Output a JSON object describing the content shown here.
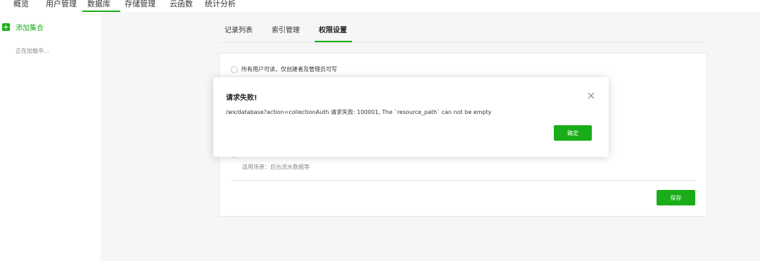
{
  "topnav": {
    "tabs": [
      "概览",
      "用户管理",
      "数据库",
      "存储管理",
      "云函数",
      "统计分析"
    ],
    "active_index": 2
  },
  "sidebar": {
    "add_label": "添加集合",
    "loading_text": "正在加载中..."
  },
  "content_tabs": {
    "tabs": [
      "记录列表",
      "索引管理",
      "权限设置"
    ],
    "active_index": 2
  },
  "permissions": {
    "option_1": "所有用户可读，仅创建者及管理员可写",
    "scene_text": "适用场景：后台流水数据等",
    "save_label": "保存"
  },
  "modal": {
    "title": "请求失败!",
    "message": "/wx/database?action=collectionAuth 请求失败: 100001, The `resource_path` can not be empty",
    "confirm_label": "确定"
  },
  "colors": {
    "accent": "#1aad19",
    "background": "#f5f6f7"
  }
}
